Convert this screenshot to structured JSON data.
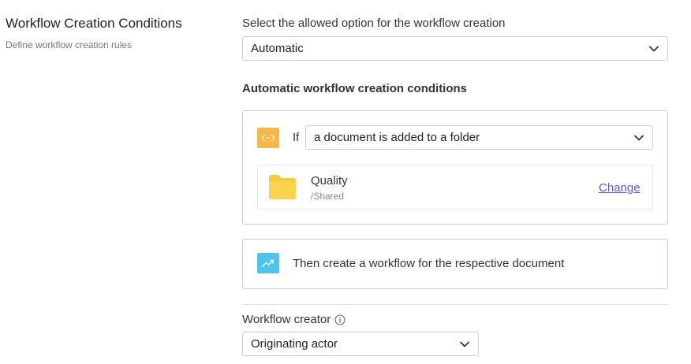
{
  "section": {
    "title": "Workflow Creation Conditions",
    "description": "Define workflow creation rules"
  },
  "creation_option": {
    "label": "Select the allowed option for the workflow creation",
    "selected": "Automatic"
  },
  "conditions": {
    "heading": "Automatic workflow creation conditions",
    "if_label": "If",
    "trigger_selected": "a document is added to a folder",
    "folder": {
      "name": "Quality",
      "path": "/Shared",
      "change_label": "Change"
    },
    "then_text": "Then create a workflow for the respective document"
  },
  "creator": {
    "label": "Workflow creator",
    "selected": "Originating actor"
  },
  "colors": {
    "trigger_icon_bg": "#f8b74a",
    "action_icon_bg": "#4fc3e8",
    "folder_yellow": "#fcd34d",
    "link": "#5b5bd6"
  },
  "icons": {
    "trigger": "code-arrows-icon",
    "action": "trending-up-icon",
    "folder": "folder-icon",
    "info": "info-icon",
    "chevron": "chevron-down-icon"
  }
}
